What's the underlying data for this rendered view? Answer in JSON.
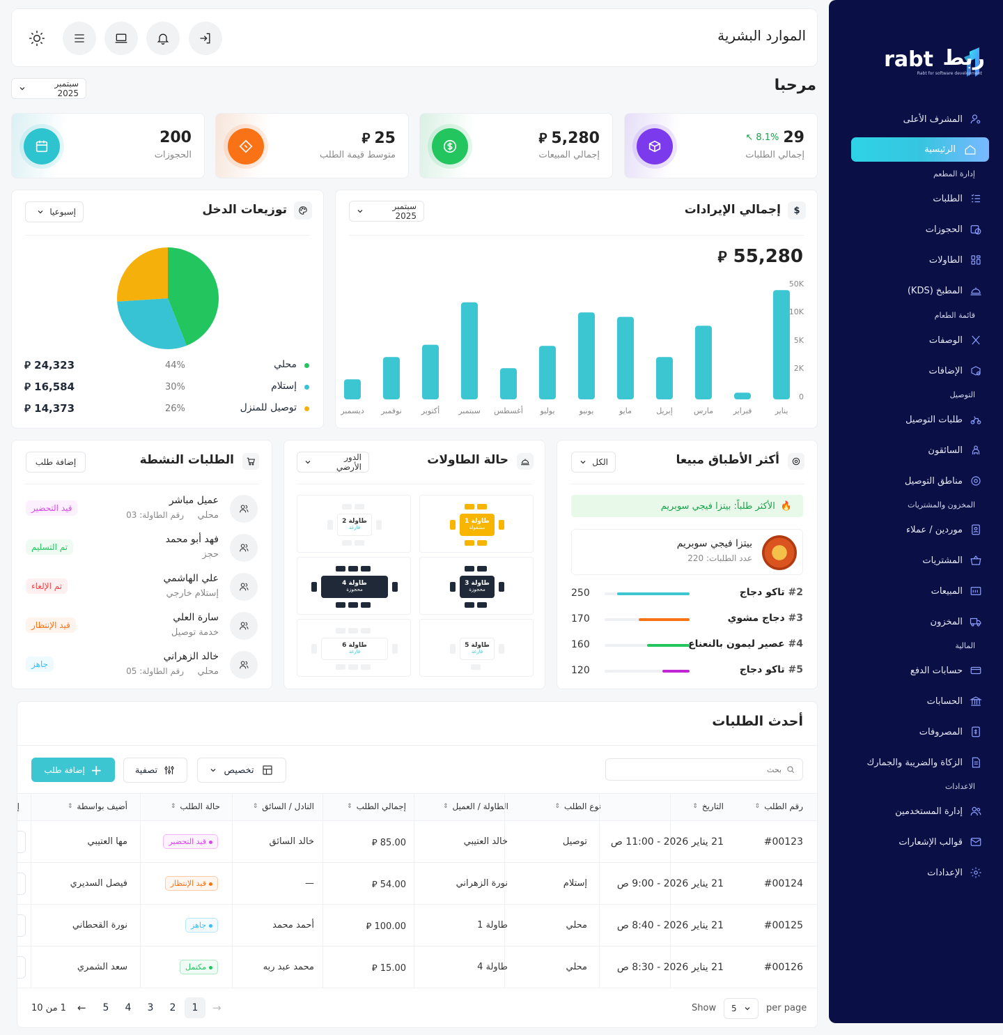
{
  "header": {
    "title": "الموارد البشرية"
  },
  "welcome": {
    "title": "مرحبا",
    "month_select": "سبتمبر 2025"
  },
  "currency_symbol": "⃁",
  "stats": [
    {
      "value": "29",
      "change": "8.1%",
      "label": "إجمالي الطلبات",
      "color": "#7c3aed",
      "icon": "box-icon"
    },
    {
      "value": "5,280",
      "label": "إجمالي المبيعات",
      "color": "#22c55e",
      "icon": "dollar-icon"
    },
    {
      "value": "25",
      "label": "متوسط قيمة الطلب",
      "color": "#f97316",
      "icon": "ticket-icon"
    },
    {
      "value": "200",
      "label": "الحجوزات",
      "color": "#2ec4cf",
      "icon": "calendar-icon"
    }
  ],
  "revenue": {
    "title": "إجمالي الإيرادات",
    "month_select": "سبتمبر 2025",
    "total": "55,280"
  },
  "chart_data": [
    {
      "type": "bar",
      "title": "إجمالي الإيرادات",
      "categories": [
        "يناير",
        "فبراير",
        "مارس",
        "إبريل",
        "مايو",
        "يونيو",
        "يوليو",
        "أغسطس",
        "سبتمبر",
        "أكتوبر",
        "نوفمبر",
        "ديسمبر"
      ],
      "values": [
        0.98,
        0.06,
        0.66,
        0.38,
        0.74,
        0.78,
        0.48,
        0.28,
        0.87,
        0.49,
        0.38,
        0.18
      ],
      "ytick_labels": [
        "0",
        "2K",
        "5K",
        "10K",
        "50K"
      ],
      "color": "#3cc6d1"
    },
    {
      "type": "pie",
      "title": "توزيعات الدخل",
      "slices": [
        {
          "label": "محلي",
          "percent": 44,
          "value": "24,323",
          "color": "#22c55e"
        },
        {
          "label": "إستلام",
          "percent": 30,
          "value": "16,584",
          "color": "#38c3d4"
        },
        {
          "label": "توصيل للمنزل",
          "percent": 26,
          "value": "14,373",
          "color": "#f5b00c"
        }
      ]
    }
  ],
  "income": {
    "title": "توزيعات الدخل",
    "period_select": "إسبوعيا"
  },
  "active_orders": {
    "title": "الطلبات النشطة",
    "add_button": "إضافة طلب",
    "items": [
      {
        "name": "عميل مباشر",
        "type": "محلي",
        "detail": "رقم الطاولة: 03",
        "status": "قيد التحضير",
        "status_color": "#d946ef"
      },
      {
        "name": "فهد أبو محمد",
        "type": "حجز",
        "detail": "",
        "status": "تم التسليم",
        "status_color": "#22c55e"
      },
      {
        "name": "علي الهاشمي",
        "type": "إستلام خارجي",
        "detail": "",
        "status": "تم الإلغاء",
        "status_color": "#ef4444"
      },
      {
        "name": "سارة العلي",
        "type": "خدمة توصيل",
        "detail": "",
        "status": "قيد الإنتظار",
        "status_color": "#f97316"
      },
      {
        "name": "خالد الزهراني",
        "type": "محلي",
        "detail": "رقم الطاولة: 05",
        "status": "جاهز",
        "status_color": "#38bdf8"
      }
    ]
  },
  "tables_status": {
    "title": "حالة الطاولات",
    "floor_select": "الدور الأرضي",
    "tables": [
      {
        "label": "طاولة 1",
        "state": "مشغولة",
        "style": "busy"
      },
      {
        "label": "طاولة 2",
        "state": "فارغة",
        "style": "empty"
      },
      {
        "label": "طاولة 3",
        "state": "محجوزة",
        "style": "reserved"
      },
      {
        "label": "طاولة 4",
        "state": "محجوزة",
        "style": "reserved"
      },
      {
        "label": "طاولة 5",
        "state": "فارغة",
        "style": "empty"
      },
      {
        "label": "طاولة 6",
        "state": "فارغة",
        "style": "empty"
      }
    ]
  },
  "top_dishes": {
    "title": "أكثر الأطباق مبيعا",
    "filter_select": "الكل",
    "banner": "الأكثر طلباً: بيتزا فيجي سوبريم",
    "featured": {
      "name": "بيتزا فيجي سوبريم",
      "orders": "عدد الطلبات: 220"
    },
    "items": [
      {
        "rank": "#2",
        "name": "تاكو دجاج",
        "count": "250",
        "ratio": 0.85,
        "color": "#3cc6d1"
      },
      {
        "rank": "#3",
        "name": "دجاج مشوي",
        "count": "170",
        "ratio": 0.6,
        "color": "#f97316"
      },
      {
        "rank": "#4",
        "name": "عصير ليمون بالنعناع",
        "count": "160",
        "ratio": 0.5,
        "color": "#22c55e"
      },
      {
        "rank": "#5",
        "name": "تاكو دجاج",
        "count": "120",
        "ratio": 0.32,
        "color": "#c026d3"
      }
    ]
  },
  "recent_orders": {
    "title": "أحدث الطلبات",
    "search_placeholder": "بحث",
    "customize_label": "تخصيص",
    "filter_label": "تصفية",
    "add_label": "إضافة طلب",
    "columns": [
      "رقم الطلب",
      "التاريخ",
      "نوع الطلب",
      "الطاولة / العميل",
      "إجمالي الطلب",
      "النادل / السائق",
      "حالة الطلب",
      "أضيف بواسطة",
      "إج"
    ],
    "rows": [
      {
        "id": "#00123",
        "date": "21 يناير 2026 - 11:00 ص",
        "type": "توصيل",
        "customer": "خالد العتيبي",
        "total": "85.00",
        "waiter": "خالد السائق",
        "status": "قيد التحضير",
        "status_color": "#d946ef",
        "added_by": "مها العتيبي"
      },
      {
        "id": "#00124",
        "date": "21 يناير 2026 - 9:00 ص",
        "type": "إستلام",
        "customer": "نورة الزهراني",
        "total": "54.00",
        "waiter": "—",
        "status": "قيد الإنتظار",
        "status_color": "#f97316",
        "added_by": "فيصل السديري"
      },
      {
        "id": "#00125",
        "date": "21 يناير 2026 - 8:40 ص",
        "type": "محلي",
        "customer": "طاولة 1",
        "total": "100.00",
        "waiter": "أحمد محمد",
        "status": "جاهز",
        "status_color": "#38bdf8",
        "added_by": "نورة القحطاني"
      },
      {
        "id": "#00126",
        "date": "21 يناير 2026 - 8:30 ص",
        "type": "محلي",
        "customer": "طاولة 4",
        "total": "15.00",
        "waiter": "محمد عبد ربه",
        "status": "مكتمل",
        "status_color": "#22c55e",
        "added_by": "سعد الشمري"
      }
    ],
    "pagination": {
      "show": "Show",
      "per_page_value": "5",
      "per_page": "per page",
      "pages": [
        "1",
        "2",
        "3",
        "4",
        "5"
      ],
      "summary": "1 من 10"
    }
  },
  "sidebar": {
    "logo_text": "rabt",
    "logo_arabic": "ربط",
    "logo_tagline": "Rabt for software development",
    "items": [
      {
        "label": "المشرف الأعلى",
        "icon": "user-gear-icon"
      },
      {
        "label": "الرئيسية",
        "icon": "home-icon",
        "active": true
      },
      {
        "section": "إدارة المطعم"
      },
      {
        "label": "الطلبات",
        "icon": "list-icon"
      },
      {
        "label": "الحجوزات",
        "icon": "calendar-clock-icon"
      },
      {
        "label": "الطاولات",
        "icon": "grid-icon"
      },
      {
        "label": "المطبخ (KDS)",
        "icon": "cloche-icon"
      },
      {
        "section": "قائمة الطعام"
      },
      {
        "label": "الوصفات",
        "icon": "utensils-icon"
      },
      {
        "label": "الإضافات",
        "icon": "box-plus-icon"
      },
      {
        "section": "التوصيل"
      },
      {
        "label": "طلبات التوصيل",
        "icon": "bike-icon"
      },
      {
        "label": "السائقون",
        "icon": "driver-icon"
      },
      {
        "label": "مناطق التوصيل",
        "icon": "target-icon"
      },
      {
        "section": "المخزون والمشتريات"
      },
      {
        "label": "موردين / عملاء",
        "icon": "contacts-icon"
      },
      {
        "label": "المشتريات",
        "icon": "basket-icon"
      },
      {
        "label": "المبيعات",
        "icon": "pos-icon"
      },
      {
        "label": "المخزون",
        "icon": "truck-icon"
      },
      {
        "section": "المالية"
      },
      {
        "label": "حسابات الدفع",
        "icon": "card-icon"
      },
      {
        "label": "الحسابات",
        "icon": "bank-icon"
      },
      {
        "label": "المصروفات",
        "icon": "expense-icon"
      },
      {
        "label": "الزكاة والضريبة والجمارك",
        "icon": "document-icon"
      },
      {
        "section": "الاعدادات"
      },
      {
        "label": "إدارة المستخدمين",
        "icon": "users-icon"
      },
      {
        "label": "قوالب الإشعارات",
        "icon": "mail-icon"
      },
      {
        "label": "الإعدادات",
        "icon": "settings-icon"
      }
    ]
  }
}
